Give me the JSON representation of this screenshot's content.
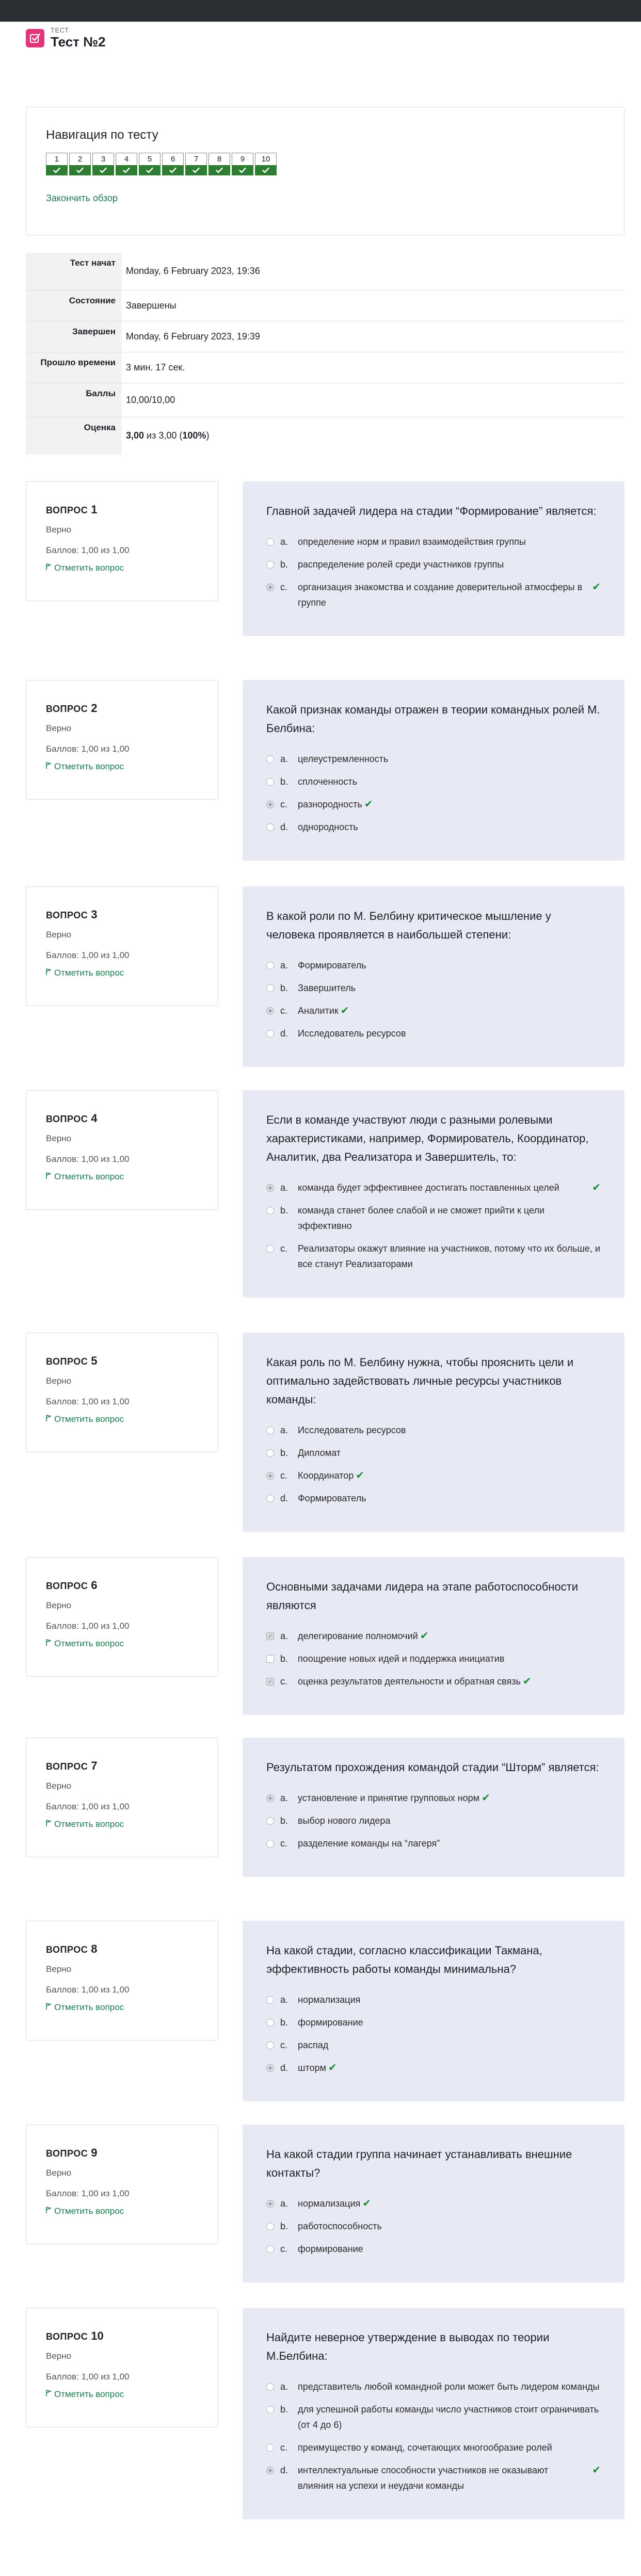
{
  "header": {
    "small": "ТЕСТ",
    "title": "Тест №2"
  },
  "nav": {
    "title": "Навигация по тесту",
    "buttons": [
      "1",
      "2",
      "3",
      "4",
      "5",
      "6",
      "7",
      "8",
      "9",
      "10"
    ],
    "finish_link": "Закончить обзор"
  },
  "summary": [
    {
      "label": "Тест начат",
      "value": "Monday, 6 February 2023, 19:36"
    },
    {
      "label": "Состояние",
      "value": "Завершены"
    },
    {
      "label": "Завершен",
      "value": "Monday, 6 February 2023, 19:39"
    },
    {
      "label": "Прошло времени",
      "value": "3 мин. 17 сек."
    },
    {
      "label": "Баллы",
      "value": "10,00/10,00"
    },
    {
      "label": "Оценка",
      "value_bold1": "3,00",
      "value_mid": " из 3,00 (",
      "value_bold2": "100%",
      "value_end": ")"
    }
  ],
  "question_common": {
    "label": "Вопрос",
    "state": "Верно",
    "grade": "Баллов: 1,00 из 1,00",
    "flag": "Отметить вопрос"
  },
  "questions": [
    {
      "number": "1",
      "text": "Главной задачей лидера на стадии “Формирование” является:",
      "input": "radio",
      "answers": [
        {
          "letter": "a.",
          "text": "определение норм и правил взаимодействия группы",
          "checked": false,
          "correct": false
        },
        {
          "letter": "b.",
          "text": "распределение ролей среди участников группы",
          "checked": false,
          "correct": false
        },
        {
          "letter": "c.",
          "text": "организация знакомства и создание доверительной атмосферы в группе",
          "checked": true,
          "correct": true,
          "tick_end": true
        }
      ]
    },
    {
      "number": "2",
      "text": "Какой признак команды отражен в теории командных ролей М. Белбина:",
      "input": "radio",
      "answers": [
        {
          "letter": "a.",
          "text": "целеустремленность",
          "checked": false,
          "correct": false
        },
        {
          "letter": "b.",
          "text": "сплоченность",
          "checked": false,
          "correct": false
        },
        {
          "letter": "c.",
          "text": "разнородность",
          "checked": true,
          "correct": true
        },
        {
          "letter": "d.",
          "text": "однородность",
          "checked": false,
          "correct": false
        }
      ]
    },
    {
      "number": "3",
      "text": "В какой роли по М. Белбину критическое мышление у человека проявляется в наибольшей степени:",
      "input": "radio",
      "answers": [
        {
          "letter": "a.",
          "text": "Формирователь",
          "checked": false,
          "correct": false
        },
        {
          "letter": "b.",
          "text": "Завершитель",
          "checked": false,
          "correct": false
        },
        {
          "letter": "c.",
          "text": "Аналитик",
          "checked": true,
          "correct": true
        },
        {
          "letter": "d.",
          "text": "Исследователь ресурсов",
          "checked": false,
          "correct": false
        }
      ]
    },
    {
      "number": "4",
      "text": "Если в команде участвуют люди с разными ролевыми характеристиками, например, Формирователь, Координатор, Аналитик, два Реализатора и Завершитель, то:",
      "input": "radio",
      "answers": [
        {
          "letter": "a.",
          "text": "команда будет эффективнее достигать поставленных целей",
          "checked": true,
          "correct": true,
          "tick_end": true
        },
        {
          "letter": "b.",
          "text": "команда станет более слабой и не сможет прийти к цели эффективно",
          "checked": false,
          "correct": false
        },
        {
          "letter": "c.",
          "text": "Реализаторы окажут влияние на участников, потому что их больше, и все станут Реализаторами",
          "checked": false,
          "correct": false
        }
      ]
    },
    {
      "number": "5",
      "text": "Какая роль по М. Белбину нужна, чтобы прояснить цели и оптимально задействовать личные ресурсы участников команды:",
      "input": "radio",
      "answers": [
        {
          "letter": "a.",
          "text": "Исследователь ресурсов",
          "checked": false,
          "correct": false
        },
        {
          "letter": "b.",
          "text": "Дипломат",
          "checked": false,
          "correct": false
        },
        {
          "letter": "c.",
          "text": "Координатор",
          "checked": true,
          "correct": true
        },
        {
          "letter": "d.",
          "text": "Формирователь",
          "checked": false,
          "correct": false
        }
      ]
    },
    {
      "number": "6",
      "text": "Основными задачами лидера на этапе работоспособности являются",
      "input": "checkbox",
      "answers": [
        {
          "letter": "a.",
          "text": "делегирование полномочий",
          "checked": true,
          "correct": true
        },
        {
          "letter": "b.",
          "text": "поощрение новых идей и поддержка инициатив",
          "checked": false,
          "correct": false
        },
        {
          "letter": "c.",
          "text": "оценка результатов деятельности и обратная связь",
          "checked": true,
          "correct": true
        }
      ]
    },
    {
      "number": "7",
      "text": "Результатом прохождения командой стадии “Шторм” является:",
      "input": "radio",
      "answers": [
        {
          "letter": "a.",
          "text": "установление и принятие групповых норм",
          "checked": true,
          "correct": true
        },
        {
          "letter": "b.",
          "text": "выбор нового лидера",
          "checked": false,
          "correct": false
        },
        {
          "letter": "c.",
          "text": "разделение команды на “лагеря”",
          "checked": false,
          "correct": false
        }
      ]
    },
    {
      "number": "8",
      "text": "На какой стадии, согласно классификации Такмана, эффективность работы команды минимальна?",
      "input": "radio",
      "answers": [
        {
          "letter": "a.",
          "text": "нормализация",
          "checked": false,
          "correct": false
        },
        {
          "letter": "b.",
          "text": "формирование",
          "checked": false,
          "correct": false
        },
        {
          "letter": "c.",
          "text": "распад",
          "checked": false,
          "correct": false
        },
        {
          "letter": "d.",
          "text": "шторм",
          "checked": true,
          "correct": true
        }
      ]
    },
    {
      "number": "9",
      "text": "На какой стадии группа начинает устанавливать внешние контакты?",
      "input": "radio",
      "answers": [
        {
          "letter": "a.",
          "text": "нормализация",
          "checked": true,
          "correct": true
        },
        {
          "letter": "b.",
          "text": "работоспособность",
          "checked": false,
          "correct": false
        },
        {
          "letter": "c.",
          "text": "формирование",
          "checked": false,
          "correct": false
        }
      ]
    },
    {
      "number": "10",
      "text": "Найдите неверное утверждение в выводах по теории М.Белбина:",
      "input": "radio",
      "answers": [
        {
          "letter": "a.",
          "text": "представитель любой командной роли может быть лидером команды",
          "checked": false,
          "correct": false
        },
        {
          "letter": "b.",
          "text": "для успешной работы команды число участников стоит ограничивать (от 4 до 6)",
          "checked": false,
          "correct": false
        },
        {
          "letter": "c.",
          "text": "преимущество у команд, сочетающих многообразие ролей",
          "checked": false,
          "correct": false
        },
        {
          "letter": "d.",
          "text": "интеллектуальные способности участников не оказывают влияния на успехи и неудачи команды",
          "checked": true,
          "correct": true,
          "tick_end": true
        }
      ]
    }
  ]
}
